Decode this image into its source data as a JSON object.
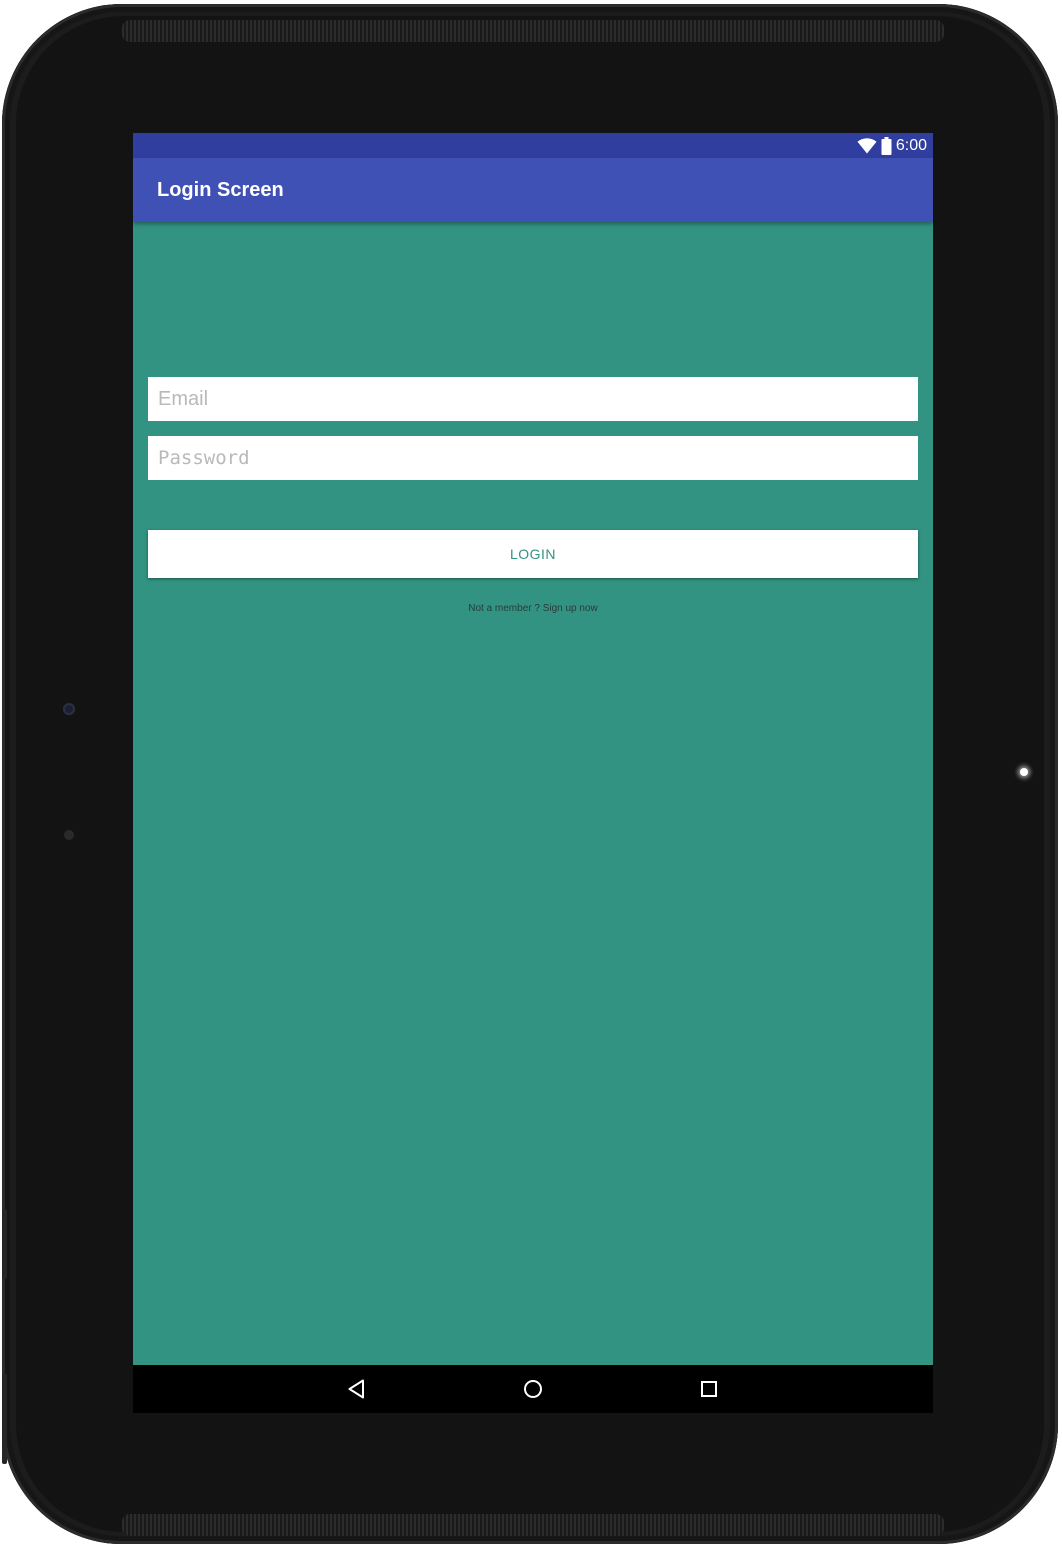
{
  "status_bar": {
    "time": "6:00",
    "wifi_icon": "wifi-icon",
    "battery_icon": "battery-icon"
  },
  "app_bar": {
    "title": "Login Screen"
  },
  "form": {
    "email": {
      "value": "",
      "placeholder": "Email"
    },
    "password": {
      "value": "",
      "placeholder": "Password"
    },
    "login_label": "LOGIN",
    "signup_text": "Not a member ? Sign up now"
  },
  "nav_bar": {
    "back_icon": "back-icon",
    "home_icon": "home-icon",
    "recents_icon": "recents-icon"
  },
  "colors": {
    "status_bar": "#303f9f",
    "app_bar": "#3f51b5",
    "background": "#329382",
    "accent_text": "#329382"
  }
}
